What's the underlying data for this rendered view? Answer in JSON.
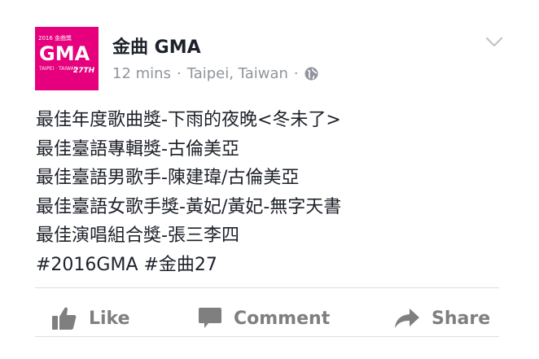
{
  "page": {
    "name": "金曲 GMA",
    "time": "12 mins",
    "separator": "·",
    "location": "Taipei, Taiwan",
    "privacy_icon": "globe-icon"
  },
  "avatar": {
    "top_text": "2016 金曲獎",
    "logo_text": "GMA",
    "sub_text": "TAIPEI · TAIWAN",
    "number": "27TH",
    "brand_color": "#e6007e"
  },
  "post": {
    "lines": [
      "最佳年度歌曲獎-下雨的夜晚<冬未了>",
      "最佳臺語專輯獎-古倫美亞",
      "最佳臺語男歌手-陳建瑋/古倫美亞",
      "最佳臺語女歌手獎-黃妃/黃妃-無字天書",
      "最佳演唱組合獎-張三李四",
      "#2016GMA #金曲27"
    ]
  },
  "actions": {
    "like_label": "Like",
    "comment_label": "Comment",
    "share_label": "Share",
    "icons": [
      "thumbs-up-icon",
      "comment-bubble-icon",
      "share-arrow-icon"
    ]
  },
  "colors": {
    "text": "#1d2129",
    "meta": "#90949c",
    "action": "#7f7f7f",
    "divider": "#dddfe2"
  }
}
